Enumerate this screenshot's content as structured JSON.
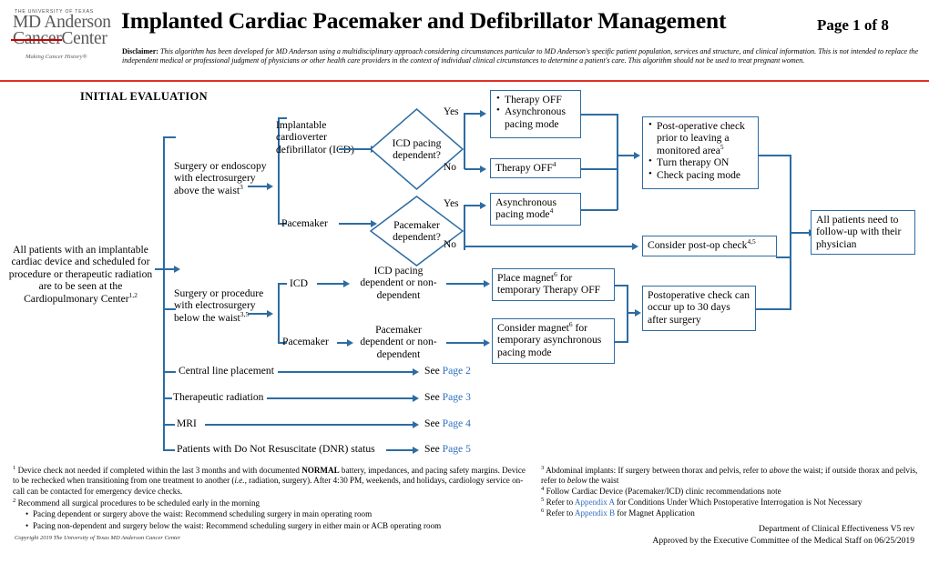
{
  "header": {
    "logo": {
      "top_line": "THE UNIVERSITY OF TEXAS",
      "line2_strike": "Cancer",
      "line2_rest": "Center",
      "line1": "MD Anderson",
      "tagline": "Making Cancer History®"
    },
    "title": "Implanted Cardiac Pacemaker and Defibrillator Management",
    "page_label": "Page 1 of 8",
    "disclaimer_bold": "Disclaimer:",
    "disclaimer": " This algorithm has been developed for MD Anderson using a multidisciplinary approach considering circumstances particular to MD Anderson's specific patient population, services and structure, and clinical information. This is not intended to replace the independent medical or professional judgment of physicians or other health care providers in the context of individual clinical circumstances to determine a patient's care. This algorithm should not be used to treat pregnant women."
  },
  "section_heading": "INITIAL EVALUATION",
  "flow": {
    "entry": "All patients with an implantable cardiac device and scheduled for procedure or therapeutic radiation are to be seen at the Cardiopulmonary Center",
    "entry_sup": "1,2",
    "branch_above": "Surgery or endoscopy with electrosurgery above the waist",
    "branch_above_sup": "3",
    "branch_below": "Surgery or procedure with electrosurgery below the waist",
    "branch_below_sup": "3,5",
    "icd_long": "Implantable cardioverter defibrillator (ICD)",
    "pacemaker": "Pacemaker",
    "icd_short": "ICD",
    "diamond_icd": "ICD pacing dependent?",
    "diamond_pacemaker": "Pacemaker dependent?",
    "yes": "Yes",
    "no": "No",
    "box_therapy_off_async_1": "Therapy OFF",
    "box_therapy_off_async_2": "Asynchronous pacing mode",
    "box_therapy_off": "Therapy OFF",
    "box_therapy_off_sup": "4",
    "box_async": "Asynchronous pacing mode",
    "box_async_sup": "4",
    "box_postop_1": "Post-operative check prior to leaving a monitored area",
    "box_postop_1_sup": "5",
    "box_postop_2": "Turn therapy ON",
    "box_postop_3": "Check pacing mode",
    "box_consider_postop": "Consider post-op check",
    "box_consider_postop_sup": "4,5",
    "icd_dep": "ICD pacing dependent or non-dependent",
    "pm_dep": "Pacemaker dependent or non-dependent",
    "box_place_magnet_a": "Place magnet",
    "box_place_magnet_sup": "6",
    "box_place_magnet_b": " for temporary Therapy OFF",
    "box_consider_magnet_a": "Consider magnet",
    "box_consider_magnet_sup": "6",
    "box_consider_magnet_b": " for temporary asynchronous pacing mode",
    "box_postop_30days": "Postoperative check can occur up to 30 days after surgery",
    "box_followup": "All patients need to follow-up with their physician",
    "links": [
      {
        "label": "Central line placement",
        "see": "See ",
        "page": "Page 2"
      },
      {
        "label": "Therapeutic radiation",
        "see": "See ",
        "page": "Page 3"
      },
      {
        "label": "MRI",
        "see": "See ",
        "page": "Page 4"
      },
      {
        "label": "Patients with Do Not Resuscitate (DNR) status",
        "see": "See ",
        "page": "Page 5"
      }
    ]
  },
  "footnotes": {
    "n1_a": "Device check not needed if completed within the last 3 months and with documented ",
    "n1_bold": "NORMAL",
    "n1_b": " battery, impedances, and pacing safety margins. Device to be rechecked when transitioning from one treatment to another (",
    "n1_ital": "i.e.",
    "n1_c": ", radiation, surgery). After 4:30 PM, weekends, and holidays, cardiology service on-call can be contacted for emergency device checks.",
    "n2": "Recommend all surgical procedures to be scheduled early in the morning",
    "n2_b1": "Pacing dependent or surgery above the waist: Recommend scheduling surgery in main operating room",
    "n2_b2": "Pacing non-dependent and surgery below the waist: Recommend scheduling surgery in either main or ACB operating room",
    "n3_a": "Abdominal implants: If surgery between thorax and pelvis, refer to ",
    "n3_i1": "above",
    "n3_b": " the waist; if outside thorax and pelvis, refer to ",
    "n3_i2": "below",
    "n3_c": " the waist",
    "n4": "Follow Cardiac Device (Pacemaker/ICD) clinic recommendations note",
    "n5_a": "Refer to ",
    "n5_link": "Appendix A",
    "n5_b": " for Conditions Under Which Postoperative Interrogation is Not Necessary",
    "n6_a": "Refer to ",
    "n6_link": "Appendix B",
    "n6_b": " for Magnet Application"
  },
  "footer": {
    "copyright": "Copyright 2019 The University of Texas MD Anderson Cancer Center",
    "dept": "Department of Clinical Effectiveness V5 rev",
    "approved": "Approved by the Executive Committee of the Medical Staff on 06/25/2019"
  },
  "colors": {
    "flow_border": "#2d6ca2",
    "rule_red": "#e03127",
    "link_blue": "#2f6fbf",
    "logo_gray": "#58595b"
  }
}
